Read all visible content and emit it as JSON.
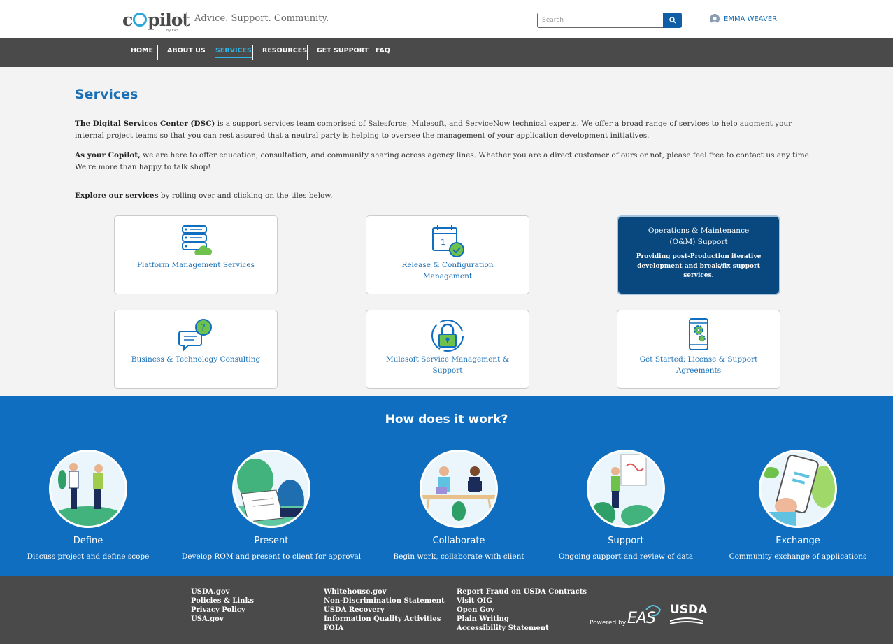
{
  "header": {
    "logo_text_c": "c",
    "logo_text_rest": "pilot",
    "logo_sub": "by EAS",
    "tagline": "Advice. Support. Community.",
    "search_placeholder": "Search",
    "user_name": "EMMA WEAVER"
  },
  "nav": {
    "items": [
      {
        "label": "HOME"
      },
      {
        "label": "ABOUT US"
      },
      {
        "label": "SERVICES",
        "active": true
      },
      {
        "label": "RESOURCES"
      },
      {
        "label": "GET SUPPORT"
      },
      {
        "label": "FAQ"
      }
    ]
  },
  "main": {
    "title": "Services",
    "para1_bold": "The Digital Services Center (DSC)",
    "para1_rest": " is a support services team comprised of Salesforce, Mulesoft, and ServiceNow technical experts. We offer a broad range of services to help augment your internal project teams so that you can rest assured that a neutral party is helping to oversee the management of your application development initiatives.",
    "para2_bold": "As your Copilot,",
    "para2_rest": " we are here to offer education, consultation, and community sharing across agency lines. Whether you are a direct customer of ours or not, please feel free to contact us any time. We're more than happy to talk shop!",
    "para3_bold": "Explore our services",
    "para3_rest": " by rolling over and clicking on the tiles below.",
    "tiles": [
      {
        "label": "Platform Management Services",
        "icon": "server-cloud-icon"
      },
      {
        "label": "Release & Configuration Management",
        "icon": "calendar-clock-icon"
      },
      {
        "title": "Operations & Maintenance (O&M) Support",
        "desc": "Providing post-Production iterative development and break/fix support services."
      },
      {
        "label": "Business & Technology Consulting",
        "icon": "chat-question-icon"
      },
      {
        "label": "Mulesoft Service Management & Support",
        "icon": "lock-icon"
      },
      {
        "label": "Get Started: License & Support Agreements",
        "icon": "mobile-gear-icon"
      }
    ]
  },
  "how": {
    "title": "How does it work?",
    "steps": [
      {
        "name": "Define",
        "desc": "Discuss project and define scope"
      },
      {
        "name": "Present",
        "desc": "Develop ROM and present to client for approval"
      },
      {
        "name": "Collaborate",
        "desc": "Begin work, collaborate with client"
      },
      {
        "name": "Support",
        "desc": "Ongoing support and review of data"
      },
      {
        "name": "Exchange",
        "desc": "Community exchange of applications"
      }
    ]
  },
  "footer": {
    "col1": [
      "USDA.gov",
      "Policies & Links",
      "Privacy Policy",
      "USA.gov"
    ],
    "col2": [
      "Whitehouse.gov",
      "Non-Discrimination Statement",
      "USDA Recovery",
      "Information Quality Activities",
      "FOIA"
    ],
    "col3": [
      "Report Fraud on USDA Contracts",
      "Visit OIG",
      "Open Gov",
      "Plain Writing",
      "Accessibility Statement"
    ],
    "powered_by": "Powered by",
    "eas": "EAS",
    "usda": "USDA"
  },
  "colors": {
    "accent": "#1a6fb5",
    "nav_bg": "#4a4a4a",
    "how_bg": "#0f6ebf",
    "dark_tile": "#08487e",
    "green": "#6ec24b"
  }
}
